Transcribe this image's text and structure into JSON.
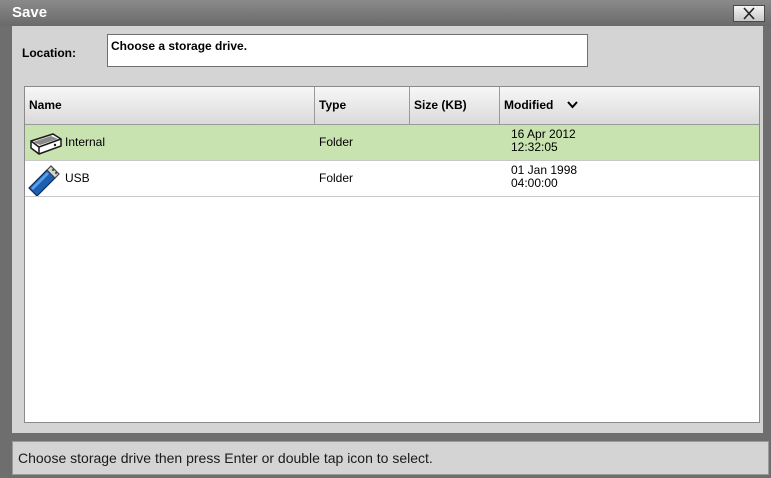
{
  "window": {
    "title": "Save"
  },
  "location": {
    "label": "Location:",
    "value": "Choose a storage drive."
  },
  "table": {
    "columns": {
      "name": "Name",
      "type": "Type",
      "size": "Size (KB)",
      "modified": "Modified"
    },
    "sort_column": "Modified",
    "rows": [
      {
        "name": "Internal",
        "type": "Folder",
        "size": "",
        "date": "16 Apr 2012",
        "time": "12:32:05",
        "icon": "hard-drive-icon",
        "selected": true
      },
      {
        "name": "USB",
        "type": "Folder",
        "size": "",
        "date": "01 Jan 1998",
        "time": "04:00:00",
        "icon": "usb-drive-icon",
        "selected": false
      }
    ]
  },
  "status": {
    "text": "Choose storage drive then press Enter or double tap icon to select."
  },
  "colors": {
    "selected_row": "#c8e2b0",
    "frame": "#6e6e6e",
    "panel": "#d4d4d4"
  }
}
